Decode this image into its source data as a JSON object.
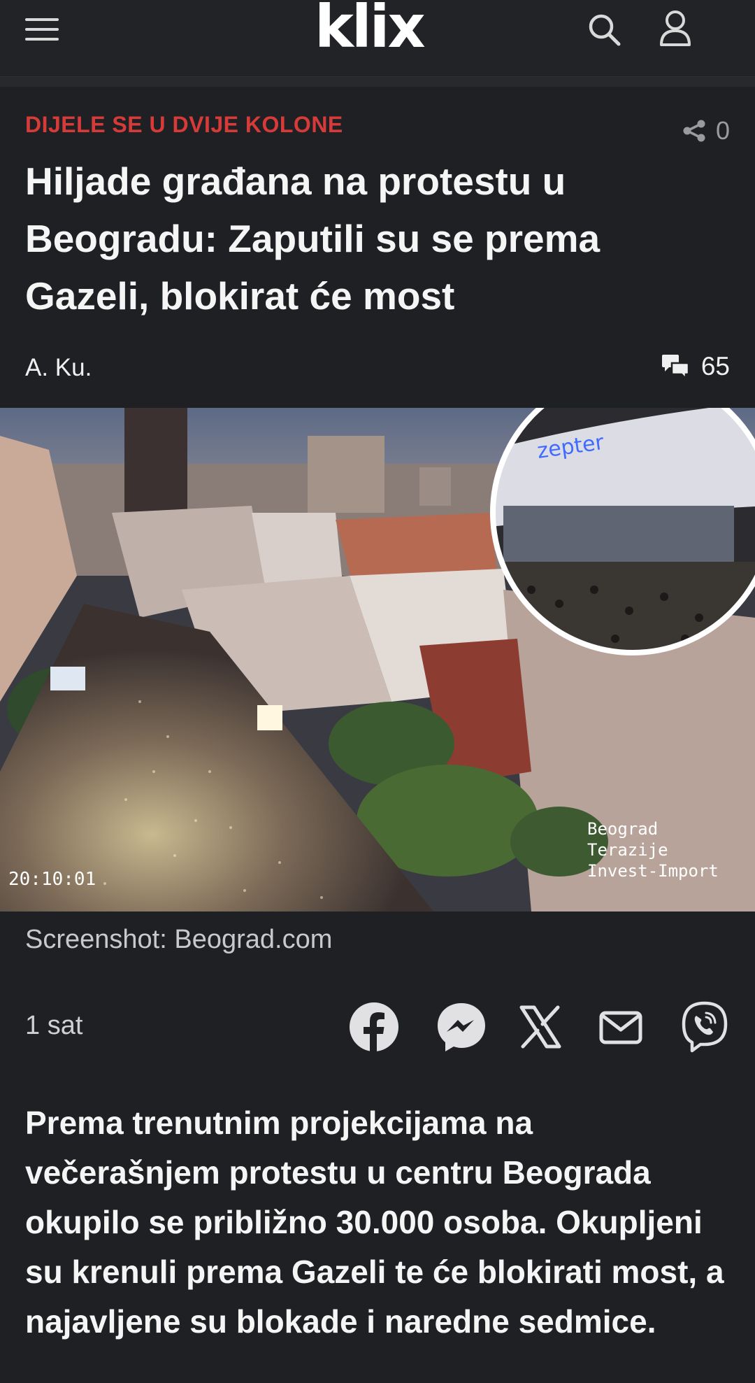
{
  "header": {
    "logo": "klix",
    "menu_icon": "hamburger-menu-icon",
    "search_icon": "search-icon",
    "user_icon": "user-icon"
  },
  "article": {
    "kicker": "DIJELE SE U DVIJE KOLONE",
    "share_count": "0",
    "title": "Hiljade građana na protestu u Beogradu: Zaputili su se prema Gazeli, blokirat će most",
    "author": "A. Ku.",
    "comment_count": "65",
    "image": {
      "timestamp_overlay": "20:10:01",
      "watermark_lines": [
        "Beograd",
        "Terazije",
        "Invest-Import"
      ],
      "inset_sign": "zepter"
    },
    "caption": "Screenshot: Beograd.com",
    "time": "1 sat",
    "share_buttons": [
      "facebook-icon",
      "messenger-icon",
      "x-icon",
      "mail-icon",
      "viber-icon"
    ],
    "lead": "Prema trenutnim projekcijama na večerašnjem protestu u centru Beograda okupilo se približno 30.000 osoba. Okupljeni su krenuli prema Gazeli te će blokirati most, a najavljene su blokade i naredne sedmice."
  },
  "colors": {
    "background": "#1f2023",
    "kicker": "#d63b3a",
    "text": "#f5f5f5",
    "muted": "#9a9b9e"
  }
}
